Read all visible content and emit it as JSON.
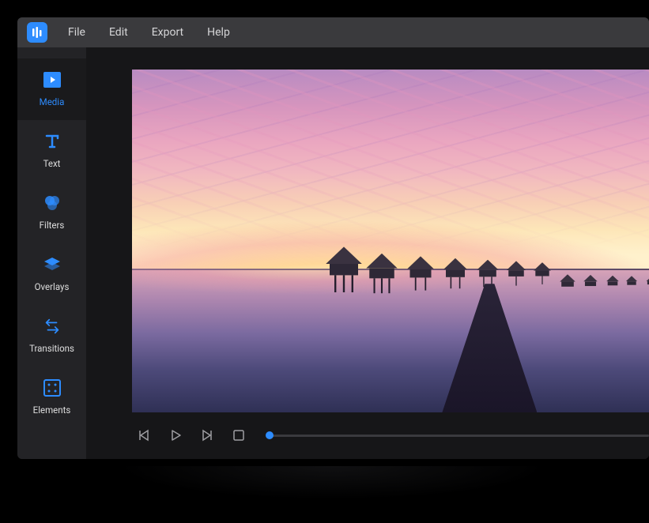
{
  "menu": {
    "items": [
      {
        "label": "File"
      },
      {
        "label": "Edit"
      },
      {
        "label": "Export"
      },
      {
        "label": "Help"
      }
    ]
  },
  "sidebar": {
    "items": [
      {
        "label": "Media",
        "icon": "media-icon",
        "active": true
      },
      {
        "label": "Text",
        "icon": "text-icon",
        "active": false
      },
      {
        "label": "Filters",
        "icon": "filters-icon",
        "active": false
      },
      {
        "label": "Overlays",
        "icon": "overlays-icon",
        "active": false
      },
      {
        "label": "Transitions",
        "icon": "transitions-icon",
        "active": false
      },
      {
        "label": "Elements",
        "icon": "elements-icon",
        "active": false
      }
    ]
  },
  "player": {
    "controls": {
      "prev": "previous-frame",
      "play": "play",
      "next": "next-frame",
      "stop": "stop"
    },
    "progress": 0
  },
  "colors": {
    "accent": "#2d8cff",
    "menubar": "#3a3a3d",
    "sidebar": "#232326",
    "content": "#161618"
  }
}
